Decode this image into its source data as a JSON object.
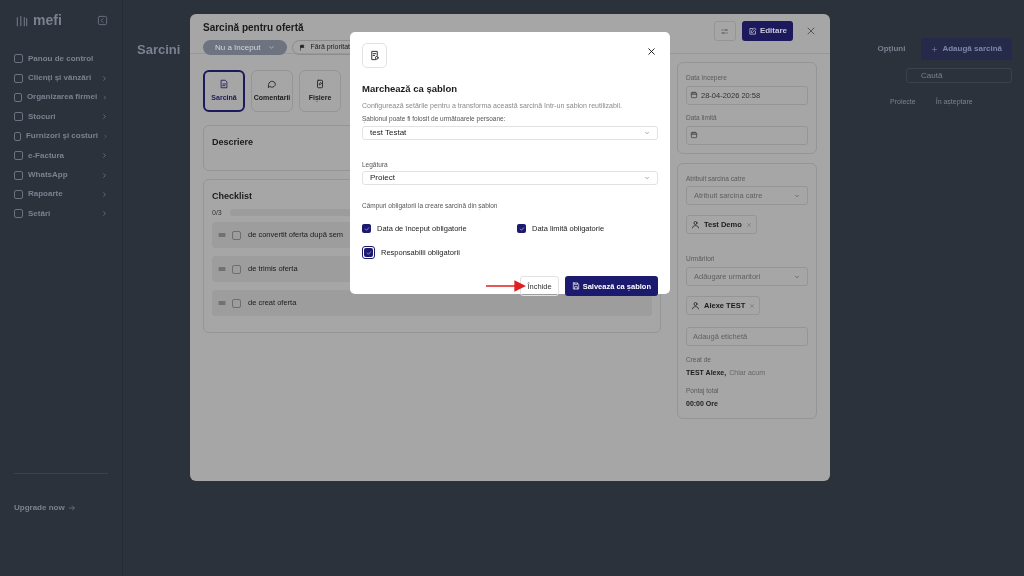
{
  "sidebar": {
    "logo": "mefi",
    "items": [
      {
        "label": "Panou de control",
        "expandable": false
      },
      {
        "label": "Clienți și vânzări",
        "expandable": true
      },
      {
        "label": "Organizarea firmei",
        "expandable": true
      },
      {
        "label": "Stocuri",
        "expandable": true
      },
      {
        "label": "Furnizori și costuri",
        "expandable": true
      },
      {
        "label": "e-Factura",
        "expandable": true
      },
      {
        "label": "WhatsApp",
        "expandable": true
      },
      {
        "label": "Rapoarte",
        "expandable": true
      },
      {
        "label": "Setări",
        "expandable": true
      }
    ],
    "upgrade": "Upgrade now"
  },
  "page": {
    "title": "Sarcini",
    "options_button": "Opțiuni",
    "add_button": "Adaugă sarcină",
    "search": {
      "placeholder": "Caută"
    },
    "columns": [
      "Proiecte",
      "În așteptare"
    ]
  },
  "task": {
    "title": "Sarcină pentru ofertă",
    "status": "Nu a început",
    "priority": "Fără prioritat",
    "edit_button": "Editare",
    "tabs": [
      {
        "label": "Sarcină",
        "selected": true
      },
      {
        "label": "Comentarii",
        "selected": false
      },
      {
        "label": "Fișiere",
        "selected": false
      }
    ],
    "description_title": "Descriere",
    "checklist": {
      "title": "Checklist",
      "count": "0/3",
      "level": 0,
      "items": [
        {
          "text": "de convertit oferta după sem",
          "checked": false
        },
        {
          "text": "de trimis oferta",
          "checked": false
        },
        {
          "text": "de creat oferta",
          "checked": false
        }
      ]
    },
    "start_date": {
      "label": "Data începere",
      "value": "28-04-2026 20:58"
    },
    "due_date": {
      "label": "Data limită"
    },
    "assignee": {
      "label": "Atribuit sarcina catre",
      "placeholder": "Atribuit sarcina catre",
      "chips": [
        "Test Demo"
      ]
    },
    "followers": {
      "label": "Urmăritori",
      "placeholder": "Adăugare urmaritori",
      "chips": [
        "Alexe TEST"
      ]
    },
    "tag": {
      "placeholder": "Adaugă etichetă"
    },
    "created": {
      "label": "Creat de",
      "author": "TEST Alexe,",
      "time": "Chiar acum"
    },
    "time_total": {
      "label": "Pontaj total",
      "value": "00:00 Ore"
    }
  },
  "dialog": {
    "title": "Marchează ca șablon",
    "description": "Configurează setările pentru a transforma această sarcină într-un șablon reutilizabil.",
    "users_label": "Șablonul poate fi folosit de următoarele persoane:",
    "users_value": "test Testat",
    "link_label": "Legătura",
    "link_value": "Proiect",
    "required_label": "Câmpuri obligatorii la creare sarcină din șablon",
    "options": [
      {
        "label": "Data de început obligatorie",
        "checked": true,
        "focused": false
      },
      {
        "label": "Data limită obligatorie",
        "checked": true,
        "focused": false
      },
      {
        "label": "Responsabilii obligatorii",
        "checked": true,
        "focused": true
      }
    ],
    "close_button": "Închide",
    "save_button": "Salvează ca șablon"
  }
}
